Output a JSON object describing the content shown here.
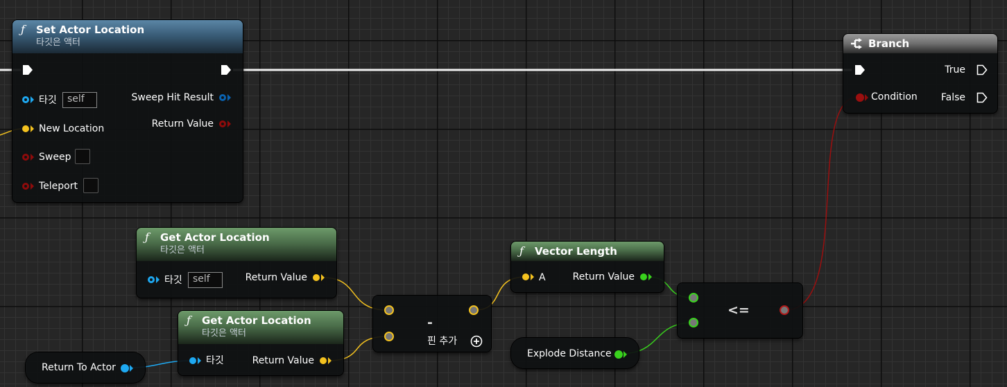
{
  "colors": {
    "exec": "#ffffff",
    "vector": "#f4c21f",
    "object": "#1ea9f2",
    "boolean": "#9b0f0f",
    "float": "#39d21d",
    "struct": "#0a62b0"
  },
  "set_actor_location": {
    "icon": "function-icon",
    "title": "Set Actor Location",
    "subtitle": "타깃은 액터",
    "inputs": {
      "target_label": "타깃",
      "target_value": "self",
      "new_location_label": "New Location",
      "sweep_label": "Sweep",
      "teleport_label": "Teleport"
    },
    "outputs": {
      "sweep_hit_result_label": "Sweep Hit Result",
      "return_value_label": "Return Value"
    }
  },
  "branch": {
    "icon": "branch-icon",
    "title": "Branch",
    "condition_label": "Condition",
    "true_label": "True",
    "false_label": "False"
  },
  "get_actor_location_1": {
    "icon": "function-icon",
    "title": "Get Actor Location",
    "subtitle": "타깃은 액터",
    "target_label": "타깃",
    "target_value": "self",
    "return_label": "Return Value"
  },
  "get_actor_location_2": {
    "icon": "function-icon",
    "title": "Get Actor Location",
    "subtitle": "타깃은 액터",
    "target_label": "타깃",
    "return_label": "Return Value"
  },
  "subtract": {
    "operator": "-",
    "add_pin_label": "핀 추가"
  },
  "vector_length": {
    "icon": "function-icon",
    "title": "Vector Length",
    "a_label": "A",
    "return_label": "Return Value"
  },
  "less_equal": {
    "operator": "<="
  },
  "return_to_actor": {
    "label": "Return To Actor"
  },
  "explode_distance": {
    "label": "Explode Distance"
  }
}
